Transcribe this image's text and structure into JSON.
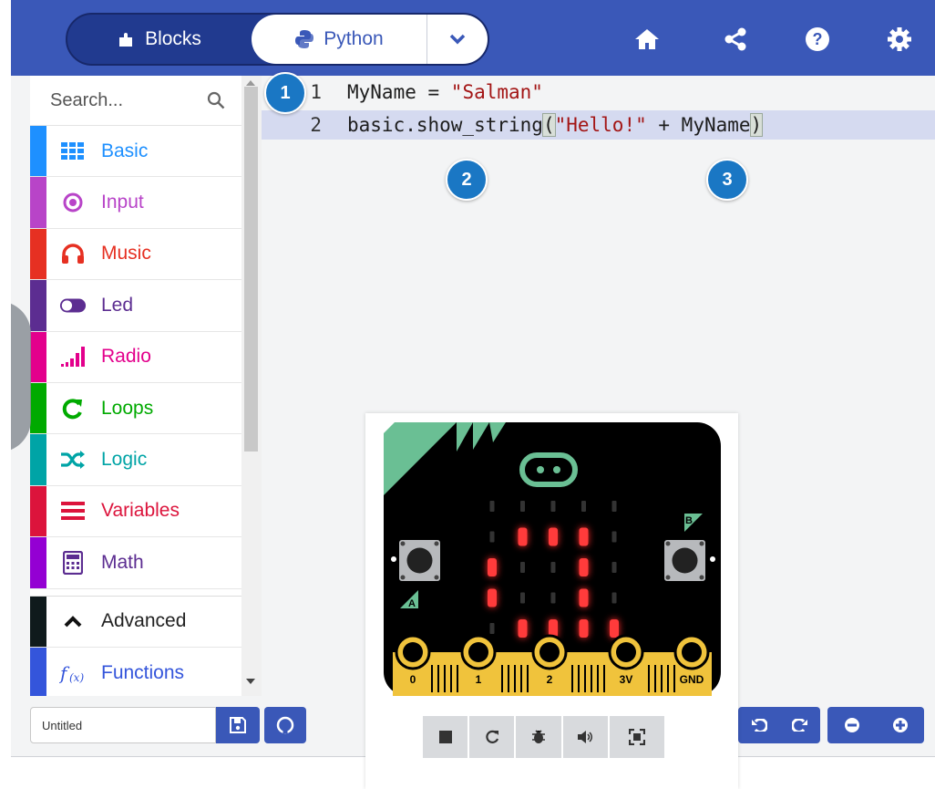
{
  "header": {
    "tabs": [
      {
        "label": "Blocks",
        "icon": "puzzle-icon",
        "active": false
      },
      {
        "label": "Python",
        "icon": "python-icon",
        "active": true
      }
    ],
    "icons": [
      "home-icon",
      "share-icon",
      "help-icon",
      "settings-icon"
    ]
  },
  "toolbox": {
    "search_placeholder": "Search...",
    "categories": [
      {
        "label": "Basic",
        "color": "#1e90ff",
        "icon": "grid-icon"
      },
      {
        "label": "Input",
        "color": "#b844c8",
        "icon": "target-icon"
      },
      {
        "label": "Music",
        "color": "#e63022",
        "icon": "headphones-icon"
      },
      {
        "label": "Led",
        "color": "#5c2d91",
        "icon": "toggle-icon"
      },
      {
        "label": "Radio",
        "color": "#e3008c",
        "icon": "signal-icon"
      },
      {
        "label": "Loops",
        "color": "#00aa00",
        "icon": "loop-icon"
      },
      {
        "label": "Logic",
        "color": "#00a4a6",
        "icon": "shuffle-icon"
      },
      {
        "label": "Variables",
        "color": "#dc143c",
        "icon": "list-icon"
      },
      {
        "label": "Math",
        "color": "#9400d3",
        "icon": "calculator-icon"
      },
      {
        "label": "Advanced",
        "color": "#000000",
        "icon": "chevron-up-icon"
      },
      {
        "label": "Functions",
        "color": "#3455db",
        "icon": "function-icon"
      }
    ]
  },
  "editor": {
    "lines": [
      {
        "num": "1",
        "parts": [
          {
            "t": "MyName = ",
            "c": "plain"
          },
          {
            "t": "\"Salman\"",
            "c": "str"
          }
        ]
      },
      {
        "num": "2",
        "parts": [
          {
            "t": "basic.show_string",
            "c": "plain"
          },
          {
            "t": "(",
            "c": "bracket"
          },
          {
            "t": "\"Hello!\"",
            "c": "str"
          },
          {
            "t": " + MyName",
            "c": "plain"
          },
          {
            "t": ")",
            "c": "bracket"
          }
        ]
      }
    ],
    "badges": [
      "1",
      "2",
      "3"
    ]
  },
  "simulator": {
    "pins": [
      "0",
      "1",
      "2",
      "3V",
      "GND"
    ],
    "button_a": "A",
    "button_b": "B",
    "leds": [
      [
        0,
        0,
        0,
        0,
        0
      ],
      [
        0,
        1,
        1,
        1,
        0
      ],
      [
        1,
        0,
        0,
        1,
        0
      ],
      [
        1,
        0,
        0,
        1,
        0
      ],
      [
        0,
        1,
        1,
        1,
        1
      ]
    ],
    "controls": [
      "stop-icon",
      "restart-icon",
      "debug-icon",
      "mute-icon",
      "fullscreen-icon"
    ]
  },
  "bottom": {
    "project_name": "Untitled",
    "save_icon": "save-icon",
    "github_icon": "github-icon"
  },
  "colors": {
    "header": "#3a58b8",
    "badge": "#1a77c4",
    "string": "#a31515"
  }
}
